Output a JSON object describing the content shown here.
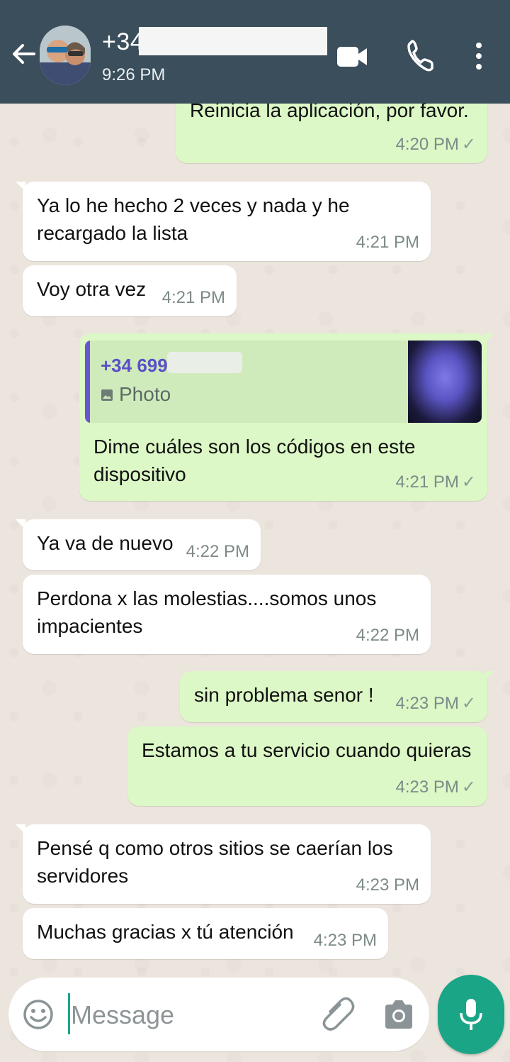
{
  "header": {
    "contact_name": "+34",
    "status": "9:26 PM"
  },
  "messages": [
    {
      "dir": "out",
      "text": "Reinicia la aplicación, por favor.",
      "time": "4:20 PM",
      "check": "✓"
    },
    {
      "dir": "in",
      "text": "Ya lo he hecho 2 veces y nada y he\nrecargado la lista",
      "time": "4:21 PM"
    },
    {
      "dir": "in",
      "text": "Voy otra vez",
      "time": "4:21 PM"
    },
    {
      "dir": "out",
      "quote_name": "+34 699",
      "quote_type": "Photo",
      "text": "Dime cuáles son los códigos en este\ndispositivo",
      "time": "4:21 PM",
      "check": "✓"
    },
    {
      "dir": "in",
      "text": "Ya va de nuevo",
      "time": "4:22 PM"
    },
    {
      "dir": "in",
      "text": "Perdona x las molestias....somos unos\nimpacientes",
      "time": "4:22 PM"
    },
    {
      "dir": "out",
      "text": "sin problema senor !",
      "time": "4:23 PM",
      "check": "✓"
    },
    {
      "dir": "out",
      "text": "Estamos a tu servicio cuando quieras",
      "time": "4:23 PM",
      "check": "✓"
    },
    {
      "dir": "in",
      "text": "Pensé q como otros sitios se caerían los\nservidores",
      "time": "4:23 PM"
    },
    {
      "dir": "in",
      "text": "Muchas gracias x tú atención",
      "time": "4:23 PM"
    }
  ],
  "composer": {
    "placeholder": "Message"
  },
  "colors": {
    "header": "#3b4e5b",
    "outgoing": "#dcf8c6",
    "incoming": "#ffffff",
    "accent": "#1aa586"
  }
}
